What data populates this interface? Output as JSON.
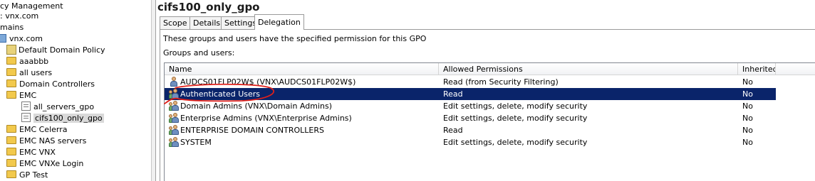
{
  "tree": {
    "items": [
      {
        "label": "cy Management",
        "icon": "none",
        "indent": 0
      },
      {
        "label": ": vnx.com",
        "icon": "none",
        "indent": 0
      },
      {
        "label": "mains",
        "icon": "none",
        "indent": 0
      },
      {
        "label": "vnx.com",
        "icon": "domain-icon",
        "indent": 1
      },
      {
        "label": "Default Domain Policy",
        "icon": "gpo-link-icon",
        "indent": 2
      },
      {
        "label": "aaabbb",
        "icon": "folder-icon",
        "indent": 2
      },
      {
        "label": "all users",
        "icon": "folder-icon",
        "indent": 2
      },
      {
        "label": "Domain Controllers",
        "icon": "folder-icon",
        "indent": 2
      },
      {
        "label": "EMC",
        "icon": "folder-icon",
        "indent": 2
      },
      {
        "label": "all_servers_gpo",
        "icon": "gpo-icon",
        "indent": 3
      },
      {
        "label": "cifs100_only_gpo",
        "icon": "gpo-icon",
        "indent": 3,
        "selected": true
      },
      {
        "label": "EMC Celerra",
        "icon": "folder-icon",
        "indent": 2
      },
      {
        "label": "EMC NAS servers",
        "icon": "folder-icon",
        "indent": 2
      },
      {
        "label": "EMC VNX",
        "icon": "folder-icon",
        "indent": 2
      },
      {
        "label": "EMC VNXe Login",
        "icon": "folder-icon",
        "indent": 2
      },
      {
        "label": "GP Test",
        "icon": "folder-icon",
        "indent": 2
      }
    ]
  },
  "main": {
    "title": "cifs100_only_gpo",
    "tabs": [
      {
        "label": "Scope",
        "active": false
      },
      {
        "label": "Details",
        "active": false
      },
      {
        "label": "Settings",
        "active": false
      },
      {
        "label": "Delegation",
        "active": true
      }
    ],
    "description": "These groups and users have the specified permission for this GPO",
    "groups_label": "Groups and users:",
    "columns": {
      "name": "Name",
      "permissions": "Allowed Permissions",
      "inherited": "Inherited"
    },
    "rows": [
      {
        "name": "AUDCS01FLP02W$ (VNX\\AUDCS01FLP02W$)",
        "permission": "Read (from Security Filtering)",
        "inherited": "No",
        "icon": "user-icon",
        "selected": false
      },
      {
        "name": "Authenticated Users",
        "permission": "Read",
        "inherited": "No",
        "icon": "group-icon",
        "selected": true
      },
      {
        "name": "Domain Admins (VNX\\Domain Admins)",
        "permission": "Edit settings, delete, modify security",
        "inherited": "No",
        "icon": "group-icon",
        "selected": false
      },
      {
        "name": "Enterprise Admins (VNX\\Enterprise Admins)",
        "permission": "Edit settings, delete, modify security",
        "inherited": "No",
        "icon": "group-icon",
        "selected": false
      },
      {
        "name": "ENTERPRISE DOMAIN CONTROLLERS",
        "permission": "Read",
        "inherited": "No",
        "icon": "group-icon",
        "selected": false
      },
      {
        "name": "SYSTEM",
        "permission": "Edit settings, delete, modify security",
        "inherited": "No",
        "icon": "group-icon",
        "selected": false
      }
    ]
  },
  "colors": {
    "selection": "#0a246a",
    "annotation": "#e0201a"
  }
}
